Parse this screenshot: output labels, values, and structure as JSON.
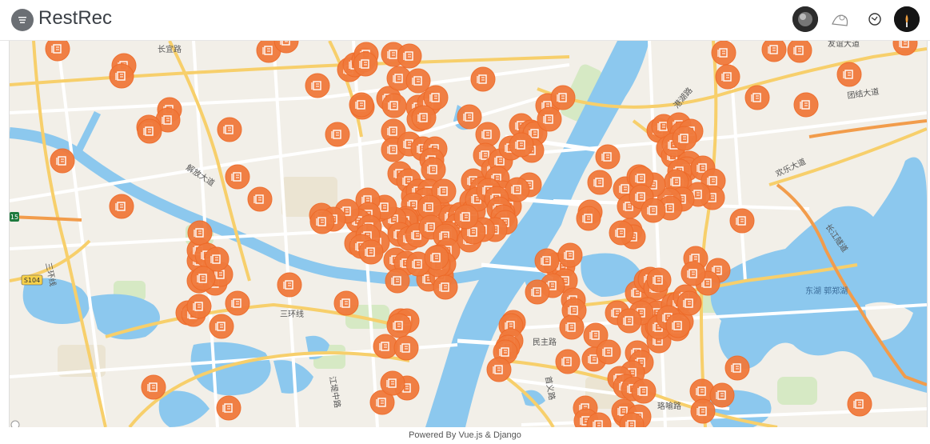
{
  "app": {
    "title": "RestRec"
  },
  "header": {
    "menu_icon": "menu-icon",
    "avatars": [
      {
        "name": "avatar-dark-photo"
      },
      {
        "name": "avatar-sketch"
      },
      {
        "name": "avatar-outline-icon"
      },
      {
        "name": "avatar-user"
      }
    ]
  },
  "map": {
    "marker_color": "#f07a3c",
    "marker_icon": "restaurant-icon",
    "labels": {
      "changyi": "长宜路",
      "jiefang": "解放大道",
      "youyi": "友谊大道",
      "tuanjie": "团结大道",
      "huanle": "欢乐大道",
      "ganghu": "港湖路",
      "sanhuan": "三环线",
      "sanhuan2": "三环线",
      "s104": "S104",
      "hwy15": "15",
      "minzhu": "民主路",
      "shouyi": "首义路",
      "jiangdi": "江堤中路",
      "luoyu": "珞喻路",
      "donghu": "东湖 郭郑湖",
      "changjiang": "长江隧道"
    }
  },
  "footer": {
    "text": "Powered By Vue.js & Django"
  }
}
